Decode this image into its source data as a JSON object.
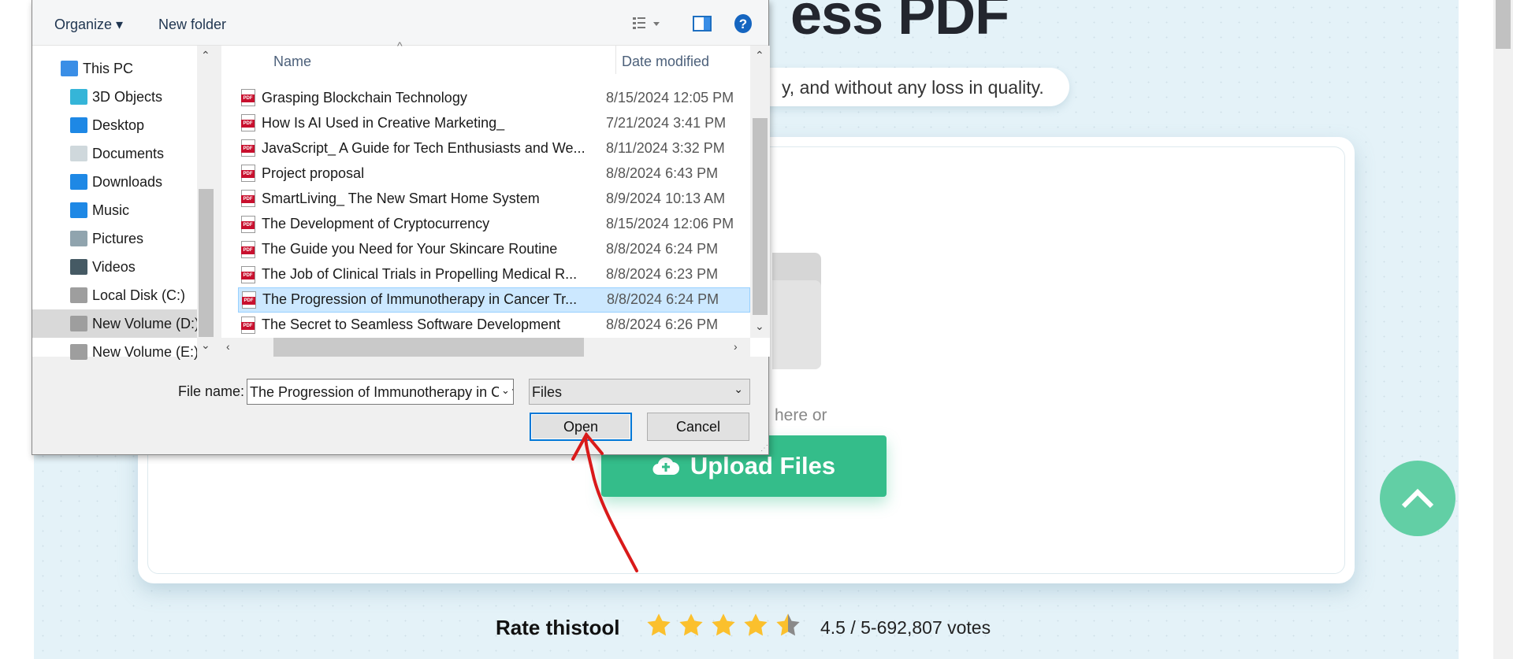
{
  "page": {
    "title_visible": "ess PDF",
    "subtitle_visible": "y, and without any loss in quality.",
    "drop_text_visible": "here or",
    "upload_button": "Upload Files",
    "rate_label": "Rate thistool",
    "rating": 4.5,
    "rating_text": "4.5 / 5-692,807 votes",
    "colors": {
      "accent": "#34bd8a",
      "scroll_top": "#62cfa5",
      "star": "#fbc02d",
      "annotation": "#d91a1a"
    }
  },
  "dialog": {
    "toolbar": {
      "organize": "Organize",
      "new_folder": "New folder",
      "icons": [
        "view-list-icon",
        "preview-pane-icon",
        "help-icon"
      ]
    },
    "nav": [
      {
        "label": "This PC",
        "icon": "computer-icon"
      },
      {
        "label": "3D Objects",
        "icon": "cube-icon"
      },
      {
        "label": "Desktop",
        "icon": "desktop-icon"
      },
      {
        "label": "Documents",
        "icon": "documents-icon"
      },
      {
        "label": "Downloads",
        "icon": "download-icon"
      },
      {
        "label": "Music",
        "icon": "music-icon"
      },
      {
        "label": "Pictures",
        "icon": "pictures-icon"
      },
      {
        "label": "Videos",
        "icon": "videos-icon"
      },
      {
        "label": "Local Disk (C:)",
        "icon": "drive-icon"
      },
      {
        "label": "New Volume (D:)",
        "icon": "drive-icon",
        "selected": true
      },
      {
        "label": "New Volume (E:)",
        "icon": "drive-icon"
      }
    ],
    "columns": {
      "name": "Name",
      "date": "Date modified"
    },
    "files": [
      {
        "name": "Grasping Blockchain Technology",
        "date": "8/15/2024 12:05 PM"
      },
      {
        "name": "How Is AI Used in Creative Marketing_",
        "date": "7/21/2024 3:41 PM"
      },
      {
        "name": "JavaScript_ A Guide for Tech Enthusiasts and We...",
        "date": "8/11/2024 3:32 PM"
      },
      {
        "name": "Project proposal",
        "date": "8/8/2024 6:43 PM"
      },
      {
        "name": "SmartLiving_ The New Smart Home System",
        "date": "8/9/2024 10:13 AM"
      },
      {
        "name": "The Development of Cryptocurrency",
        "date": "8/15/2024 12:06 PM"
      },
      {
        "name": "The Guide you Need for Your Skincare Routine",
        "date": "8/8/2024 6:24 PM"
      },
      {
        "name": "The Job of Clinical Trials in Propelling Medical R...",
        "date": "8/8/2024 6:23 PM"
      },
      {
        "name": "The Progression of Immunotherapy in Cancer Tr...",
        "date": "8/8/2024 6:24 PM",
        "selected": true
      },
      {
        "name": "The Secret to Seamless Software Development",
        "date": "8/8/2024 6:26 PM"
      }
    ],
    "file_name_label": "File name:",
    "file_name_value": "The Progression of Immunotherapy in Cancer Treatment",
    "file_type": "Files",
    "open_button": "Open",
    "cancel_button": "Cancel"
  }
}
